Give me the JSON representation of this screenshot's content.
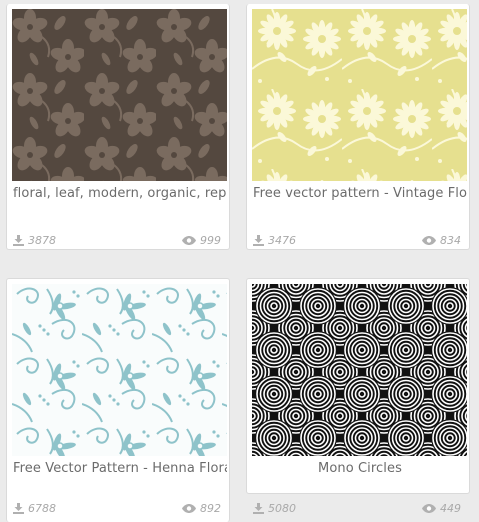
{
  "cards": [
    {
      "caption": "floral, leaf, modern, organic, repeat",
      "downloads": "3878",
      "views": "999",
      "colors": {
        "bg": "#54483f",
        "motif": "#7a6b5f"
      }
    },
    {
      "caption": "Free vector pattern - Vintage Floral",
      "downloads": "3476",
      "views": "834",
      "colors": {
        "bg": "#e6e08f",
        "motif": "#fbf8d8"
      }
    },
    {
      "caption": "Free Vector Pattern - Henna Floral",
      "downloads": "6788",
      "views": "892",
      "colors": {
        "bg": "#f9fcfc",
        "motif": "#8ec3ca"
      }
    },
    {
      "caption": "Mono Circles",
      "downloads": "5080",
      "views": "449",
      "colors": {
        "bg": "#111111",
        "motif": "#ffffff"
      }
    }
  ],
  "icons": {
    "download": "download-icon",
    "views": "eye-icon"
  }
}
